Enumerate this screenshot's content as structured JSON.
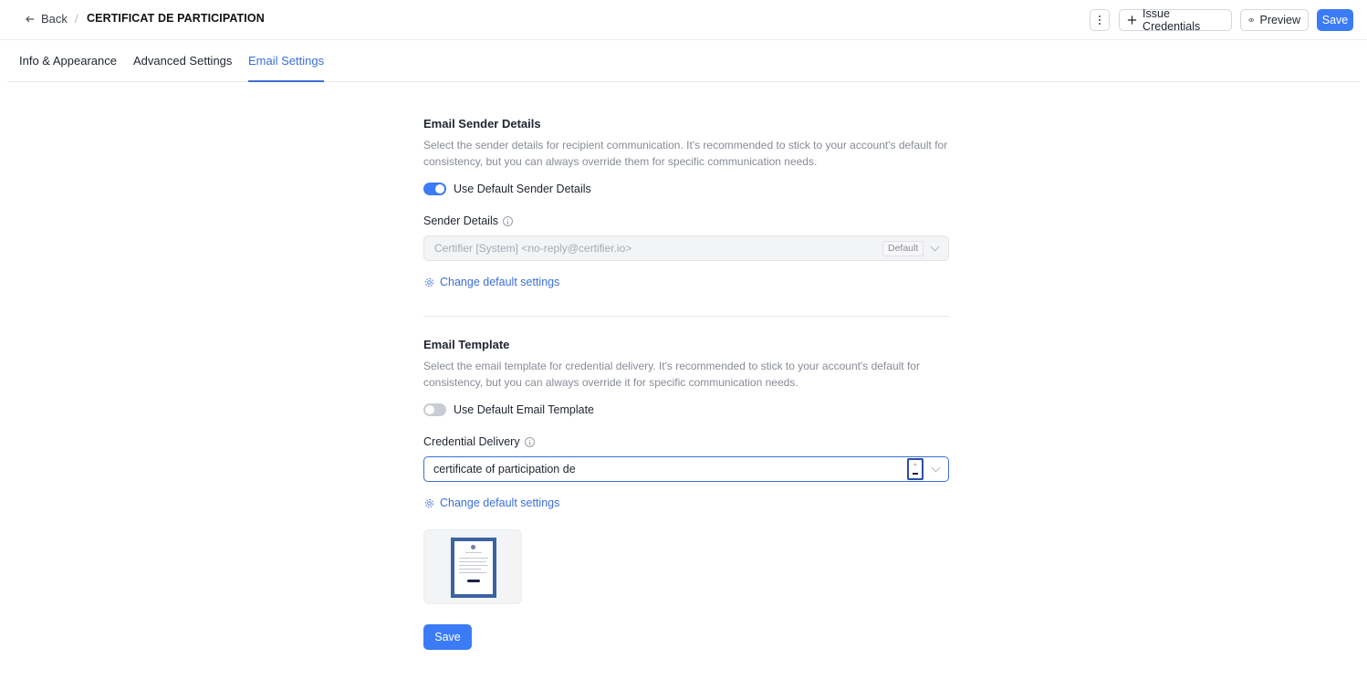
{
  "header": {
    "back_label": "Back",
    "separator": "/",
    "title": "CERTIFICAT DE PARTICIPATION",
    "issue_label": "Issue Credentials",
    "preview_label": "Preview",
    "save_label": "Save"
  },
  "tabs": [
    {
      "label": "Info & Appearance",
      "active": false
    },
    {
      "label": "Advanced Settings",
      "active": false
    },
    {
      "label": "Email Settings",
      "active": true
    }
  ],
  "sender": {
    "title": "Email Sender Details",
    "description": "Select the sender details for recipient communication. It's recommended to stick to your account's default for consistency, but you can always override them for specific communication needs.",
    "toggle_label": "Use Default Sender Details",
    "toggle_on": true,
    "field_label": "Sender Details",
    "field_value": "Certifier [System] <no-reply@certifier.io>",
    "badge": "Default",
    "link_label": "Change default settings"
  },
  "template": {
    "title": "Email Template",
    "description": "Select the email template for credential delivery. It's recommended to stick to your account's default for consistency, but you can always override it for specific communication needs.",
    "toggle_label": "Use Default Email Template",
    "toggle_on": false,
    "field_label": "Credential Delivery",
    "field_value": "certificate of participation de",
    "link_label": "Change default settings"
  },
  "footer": {
    "save_label": "Save"
  },
  "colors": {
    "accent": "#3b7cf6",
    "link": "#3b6fd8",
    "thumb_frame": "#3a64a0"
  }
}
